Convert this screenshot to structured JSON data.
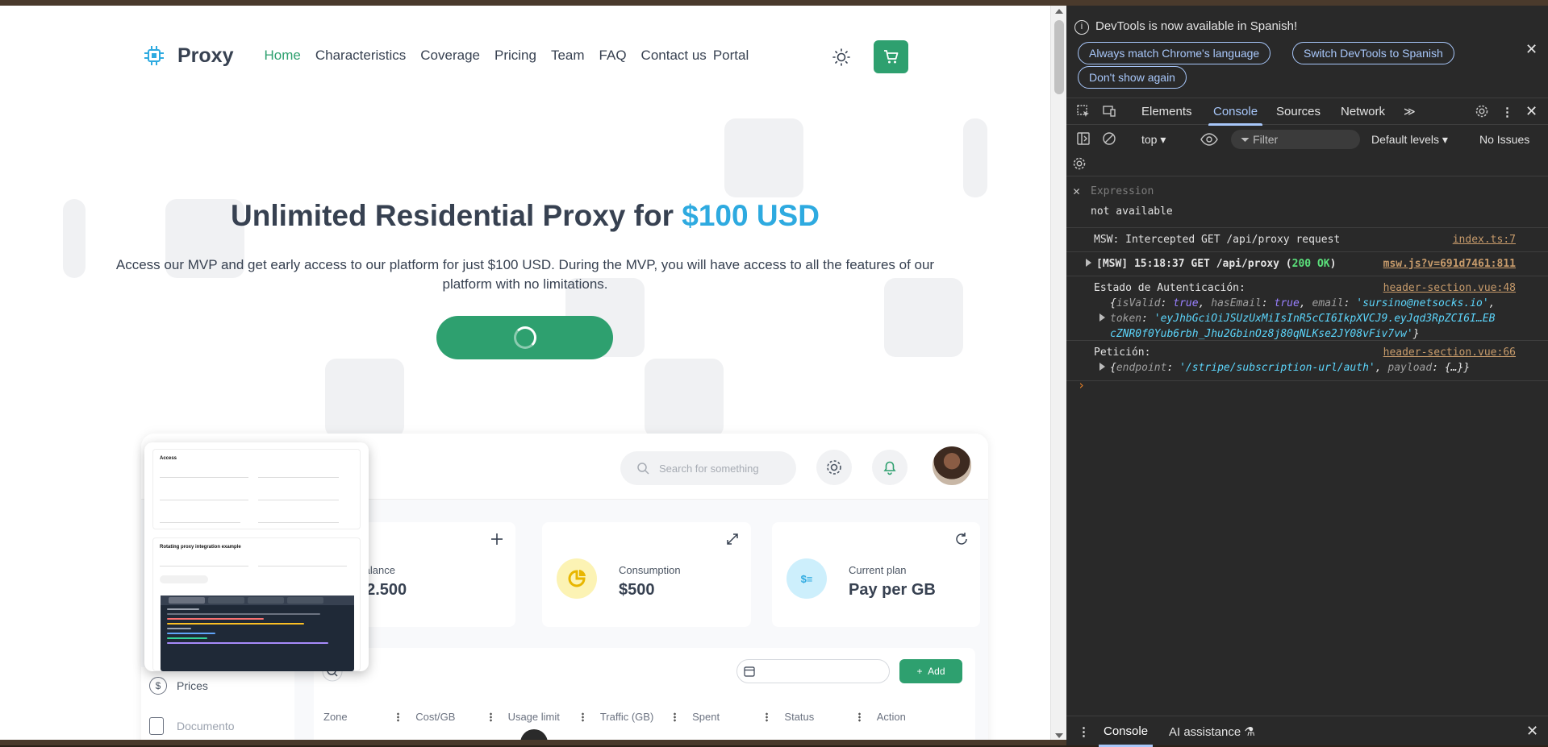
{
  "site": {
    "brand": "Proxy",
    "nav": [
      "Home",
      "Characteristics",
      "Coverage",
      "Pricing",
      "Team",
      "FAQ",
      "Contact us"
    ],
    "portal": "Portal",
    "accent_color": "#2ea06f",
    "hero": {
      "title": "Unlimited Residential Proxy for ",
      "title_accent": "$100 USD",
      "subtitle": "Access our MVP and get early access to our platform for just $100 USD. During the MVP, you will have access to all the features of our platform with no limitations."
    },
    "dashboard": {
      "search_placeholder": "Search for something",
      "cards": [
        {
          "label": "Balance",
          "value": "$2.500",
          "icon": "plus-icon"
        },
        {
          "label": "Consumption",
          "value": "$500",
          "icon": "pie-chart-icon"
        },
        {
          "label": "Current plan",
          "value": "Pay per GB",
          "icon": "coins-icon"
        }
      ],
      "add_label": "Add",
      "columns": [
        "Zone",
        "Cost/GB",
        "Usage limit",
        "Traffic (GB)",
        "Spent",
        "Status",
        "Action"
      ],
      "sidebar": [
        "Prices",
        "Documento"
      ],
      "overlay": {
        "section1_title": "Access",
        "section2_title": "Rotating proxy integration example"
      }
    }
  },
  "devtools": {
    "notice": "DevTools is now available in Spanish!",
    "notice_buttons": [
      "Always match Chrome's language",
      "Switch DevTools to Spanish",
      "Don't show again"
    ],
    "tabs": [
      "Elements",
      "Console",
      "Sources",
      "Network"
    ],
    "active_tab": "Console",
    "toolbar": {
      "context": "top",
      "filter_placeholder": "Filter",
      "levels": "Default levels",
      "issues": "No Issues"
    },
    "expression": {
      "placeholder": "Expression",
      "value": "not available"
    },
    "logs": {
      "l1": {
        "text": "MSW: Intercepted GET /api/proxy request",
        "src": "index.ts:7"
      },
      "l2": {
        "prefix": "[MSW] 15:18:37 GET /api/proxy (",
        "status": "200 OK",
        "suffix": ")",
        "src": "msw.js?v=691d7461:811"
      },
      "l3": {
        "text": "Estado de Autenticación:",
        "src": "header-section.vue:48",
        "obj_line": "{isValid: true, hasEmail: true, email: 'sursino@netsocks.io',",
        "isValid": "true",
        "hasEmail": "true",
        "email": "'sursino@netsocks.io'",
        "token": "'eyJhbGciOiJSUzUxMiIsInR5cCI6IkpXVCJ9.eyJqd3RpZCI6I…EB",
        "token2": "cZNR0f0Yub6rbh_Jhu2GbinOz8j80qNLKse2JY08vFiv7vw'"
      },
      "l4": {
        "text": "Petición:",
        "src": "header-section.vue:66",
        "endpoint": "'/stripe/subscription-url/auth'",
        "payload": "{…}"
      }
    },
    "drawer_tabs": [
      "Console",
      "AI assistance"
    ]
  }
}
